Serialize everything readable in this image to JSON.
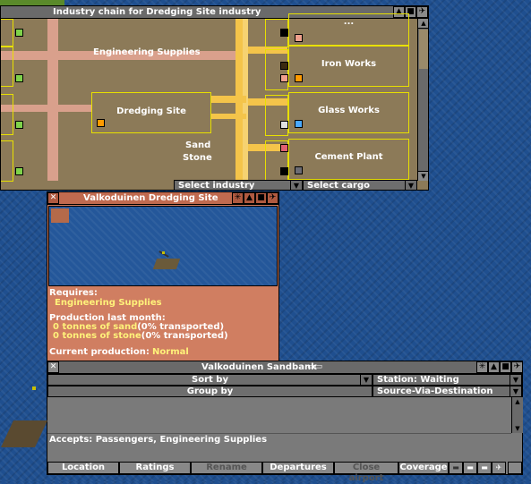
{
  "chain_window": {
    "title": "Industry chain for Dredging Site industry",
    "top_cut_label": "...",
    "left_labels": [
      "Engineering Supplies"
    ],
    "center_industry": "Dredging Site",
    "cargo_labels": [
      "Sand",
      "Stone"
    ],
    "right_industries": [
      "Iron Works",
      "Glass Works",
      "Cement Plant"
    ],
    "select_industry": "Select industry",
    "select_cargo": "Select cargo"
  },
  "industry_window": {
    "title": "Valkoduinen Dredging Site",
    "requires_label": "Requires:",
    "requires_value": "Engineering Supplies",
    "production_label": "Production last month:",
    "production_lines": [
      {
        "cargo": "0 tonnes of sand",
        "pct": "(0% transported)"
      },
      {
        "cargo": "0 tonnes of stone",
        "pct": "(0% transported)"
      }
    ],
    "current_production_label": "Current production:",
    "current_production_value": "Normal"
  },
  "station_window": {
    "title": "Valkoduinen Sandbank",
    "sort_by": "Sort by",
    "group_by": "Group by",
    "station_status": "Station: Waiting",
    "grouping": "Source-Via-Destination",
    "accepts": "Accepts: Passengers, Engineering Supplies",
    "buttons": {
      "location": "Location",
      "ratings": "Ratings",
      "rename": "Rename",
      "departures": "Departures",
      "close_airport": "Close airport",
      "coverage": "Coverage"
    }
  },
  "colors": {
    "chain_bg": "#8c7a58",
    "industry_bg": "#d07e61",
    "station_bg": "#7a7a7a",
    "road_pink": "#d9a08c",
    "cargo_yellow": "#f4c44a"
  },
  "icons": [
    "close-icon",
    "shade-icon",
    "sticky-icon",
    "pin-icon",
    "bus-icon",
    "truck-icon",
    "ship-icon",
    "plane-icon",
    "dropdown-arrow-icon"
  ]
}
